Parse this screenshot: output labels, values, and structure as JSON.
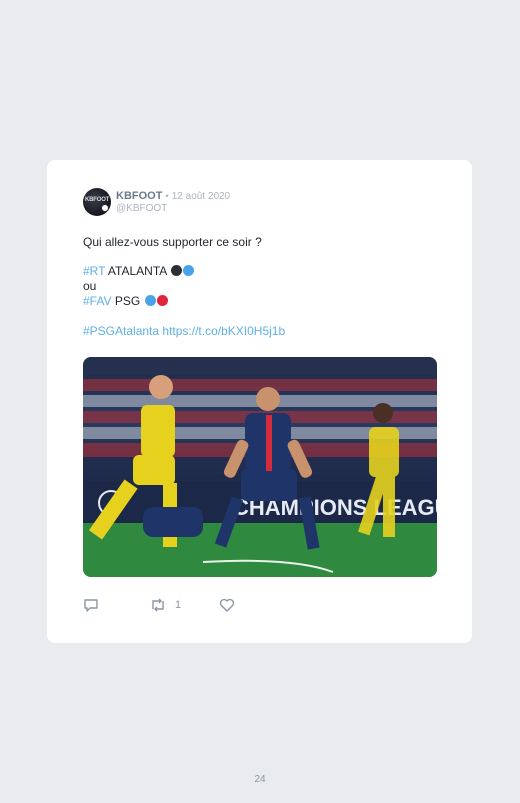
{
  "tweet": {
    "avatar_text": "KBFOOT",
    "username": "KBFOOT",
    "separator": "•",
    "date": "12 août 2020",
    "handle": "@KBFOOT",
    "question": "Qui allez-vous supporter ce soir ?",
    "option1": {
      "hashtag": "#RT",
      "team": "ATALANTA",
      "colors": [
        "#2b2f36",
        "#4aa3e8"
      ]
    },
    "or_text": "ou",
    "option2": {
      "hashtag": "#FAV",
      "team": "PSG",
      "colors": [
        "#4aa3e8",
        "#e0243b"
      ]
    },
    "hashtag_line": "#PSGAtalanta",
    "link": "https://t.co/bKXI0H5j1b",
    "media_banner": "CHAMPIONS LEAGUE",
    "actions": {
      "reply_icon": "reply-icon",
      "retweet_icon": "retweet-icon",
      "retweet_count": "1",
      "like_icon": "heart-icon"
    }
  },
  "footer": {
    "page_number": "24"
  },
  "colors": {
    "accent": "#5eb0e5",
    "background": "#e9ebef",
    "card": "#ffffff"
  }
}
